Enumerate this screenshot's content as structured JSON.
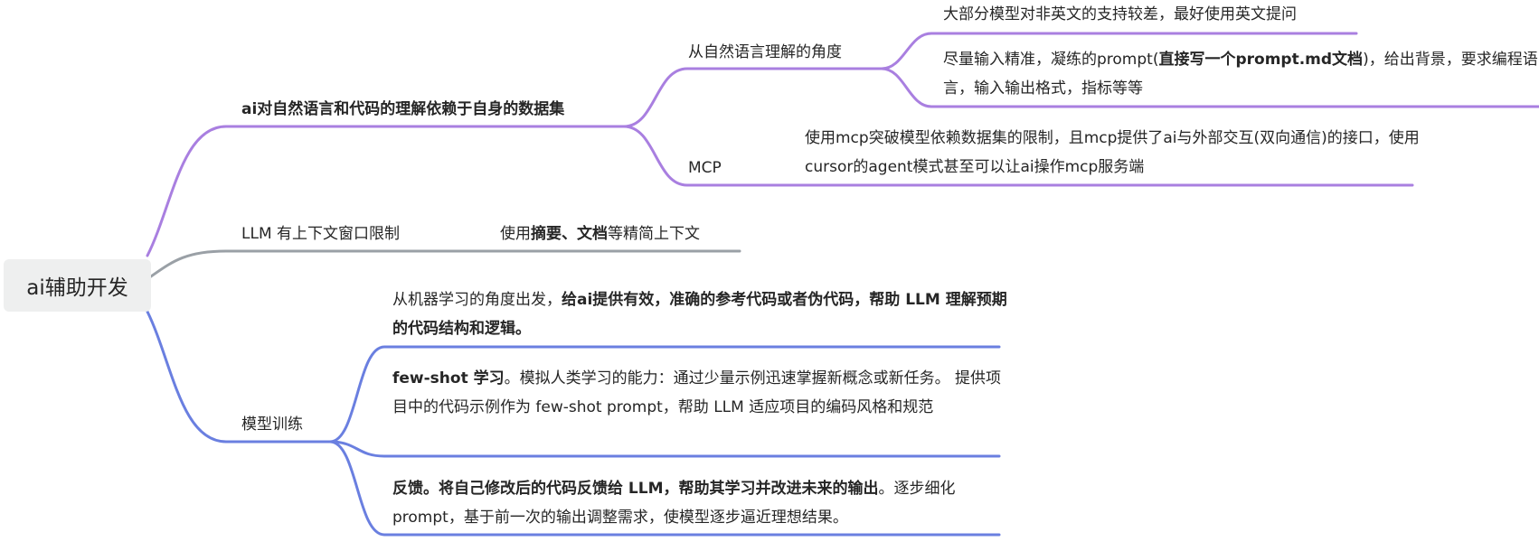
{
  "colors": {
    "purple": "#a97fe0",
    "gray": "#9aa0a6",
    "blue": "#6a7fe0"
  },
  "root": {
    "label": "ai辅助开发"
  },
  "branch_data": {
    "label": "ai对自然语言和代码的理解依赖于自身的数据集",
    "nl": {
      "label": "从自然语言理解的角度",
      "leaf1": "大部分模型对非英文的支持较差，最好使用英文提问",
      "leaf2": {
        "p1": "尽量输入精准，凝练的prompt(",
        "bold": "直接写一个prompt.md文档",
        "p2": ")，给出背景，要求编程语言，输入输出格式，指标等等"
      }
    },
    "mcp": {
      "label": "MCP",
      "leaf": "使用mcp突破模型依赖数据集的限制，且mcp提供了ai与外部交互(双向通信)的接口，使用cursor的agent模式甚至可以让ai操作mcp服务端"
    }
  },
  "branch_llm": {
    "label": "LLM 有上下文窗口限制",
    "leaf": {
      "p1": "使用",
      "bold": "摘要、文档",
      "p2": "等精简上下文"
    }
  },
  "branch_train": {
    "label": "模型训练",
    "leaf1": {
      "p1": "从机器学习的角度出发，",
      "bold": "给ai提供有效，准确的参考代码或者伪代码，帮助 LLM 理解预期的代码结构和逻辑。"
    },
    "leaf2": {
      "bold": "few-shot 学习",
      "p2": "。模拟人类学习的能力：通过少量示例迅速掌握新概念或新任务。 提供项目中的代码示例作为 few-shot prompt，帮助 LLM 适应项目的编码风格和规范"
    },
    "leaf3": {
      "bold": "反馈。将自己修改后的代码反馈给 LLM，帮助其学习并改进未来的输出",
      "p2": "。逐步细化 prompt，基于前一次的输出调整需求，使模型逐步逼近理想结果。"
    }
  }
}
